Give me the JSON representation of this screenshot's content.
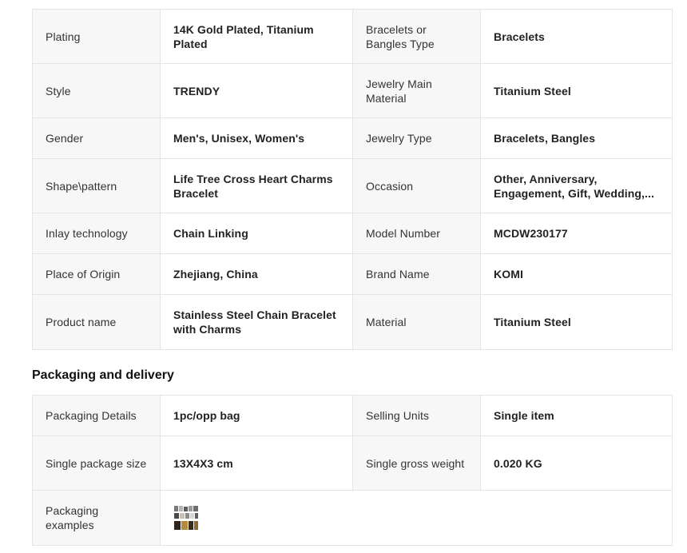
{
  "attributes": [
    [
      {
        "label": "Plating",
        "value": "14K Gold Plated, Titanium Plated"
      },
      {
        "label": "Bracelets or Bangles Type",
        "value": "Bracelets"
      }
    ],
    [
      {
        "label": "Style",
        "value": "TRENDY"
      },
      {
        "label": "Jewelry Main Material",
        "value": "Titanium Steel"
      }
    ],
    [
      {
        "label": "Gender",
        "value": "Men's, Unisex, Women's"
      },
      {
        "label": "Jewelry Type",
        "value": "Bracelets, Bangles"
      }
    ],
    [
      {
        "label": "Shape\\pattern",
        "value": "Life Tree Cross Heart Charms Bracelet"
      },
      {
        "label": "Occasion",
        "value": "Other, Anniversary, Engagement, Gift, Wedding,..."
      }
    ],
    [
      {
        "label": "Inlay technology",
        "value": "Chain Linking"
      },
      {
        "label": "Model Number",
        "value": "MCDW230177"
      }
    ],
    [
      {
        "label": "Place of Origin",
        "value": "Zhejiang, China"
      },
      {
        "label": "Brand Name",
        "value": "KOMI"
      }
    ],
    [
      {
        "label": "Product name",
        "value": "Stainless Steel Chain Bracelet with Charms"
      },
      {
        "label": "Material",
        "value": "Titanium Steel"
      }
    ]
  ],
  "packaging": {
    "title": "Packaging and delivery",
    "rows": [
      [
        {
          "label": "Packaging Details",
          "value": "1pc/opp bag"
        },
        {
          "label": "Selling Units",
          "value": "Single item"
        }
      ],
      [
        {
          "label": "Single package size",
          "value": "13X4X3 cm"
        },
        {
          "label": "Single gross weight",
          "value": "0.020 KG"
        }
      ]
    ],
    "examples_label": "Packaging examples",
    "examples_thumbnail_icon": "packaging-photo-thumbnail"
  }
}
